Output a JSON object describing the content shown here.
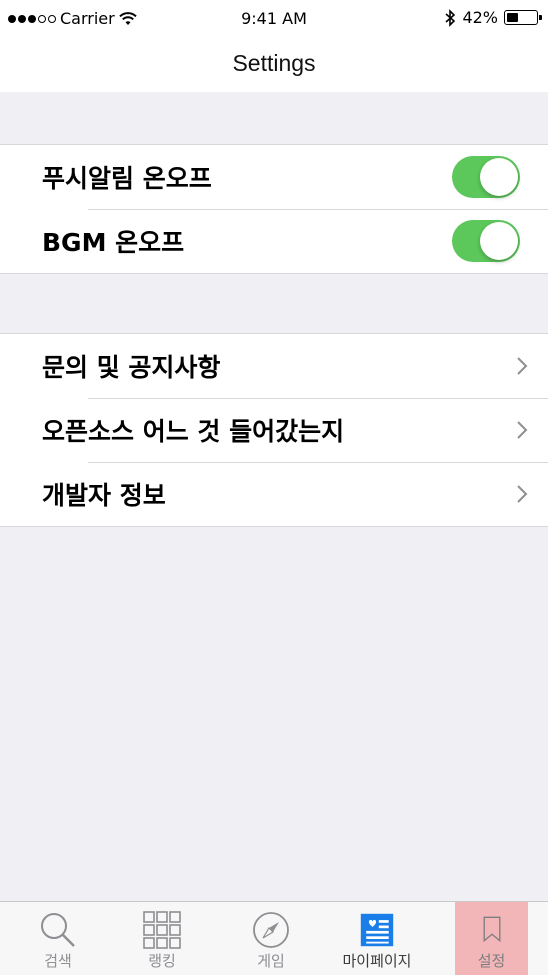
{
  "status_bar": {
    "carrier": "Carrier",
    "time": "9:41 AM",
    "battery_percent": "42%",
    "battery_level": 0.42,
    "signal_bars_filled": 3,
    "signal_bars_total": 5
  },
  "nav": {
    "title": "Settings"
  },
  "toggle_group": {
    "items": [
      {
        "label": "푸시알림 온오프",
        "on": true
      },
      {
        "label": "BGM 온오프",
        "on": true
      }
    ]
  },
  "link_group": {
    "items": [
      {
        "label": "문의 및 공지사항"
      },
      {
        "label": "오픈소스 어느 것 들어갔는지"
      },
      {
        "label": "개발자 정보"
      }
    ]
  },
  "tabbar": {
    "tabs": [
      {
        "label": "검색",
        "icon": "search-icon"
      },
      {
        "label": "랭킹",
        "icon": "grid-icon"
      },
      {
        "label": "게임",
        "icon": "compass-icon"
      },
      {
        "label": "마이페이지",
        "icon": "mypage-icon"
      },
      {
        "label": "설정",
        "icon": "bookmark-icon",
        "active": true
      }
    ],
    "colors": {
      "active_bg": "#f2b6b8",
      "mypage_icon": "#1a7ee8",
      "toggle_on": "#5cc75a"
    }
  }
}
